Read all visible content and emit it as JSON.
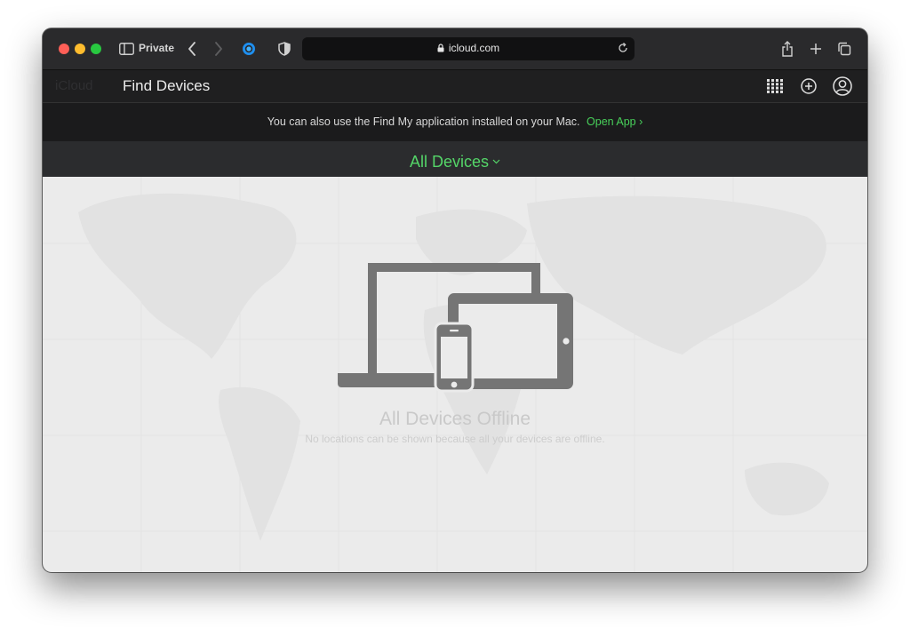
{
  "browser": {
    "private_label": "Private",
    "address": "icloud.com"
  },
  "header": {
    "ghost_brand": "iCloud",
    "title": "Find Devices",
    "icons": [
      "apps-grid-icon",
      "add-circle-icon",
      "account-icon"
    ]
  },
  "banner": {
    "message": "You can also use the Find My application installed on your Mac.",
    "link_label": "Open App",
    "link_arrow": "›"
  },
  "devices_menu": {
    "label": "All Devices"
  },
  "empty_state": {
    "title": "All Devices Offline",
    "subtitle": "No locations can be shown because all your devices are offline."
  },
  "colors": {
    "accent_green": "#48d05a",
    "traffic_close": "#ff5f57",
    "traffic_minimize": "#febc2e",
    "traffic_zoom": "#28c840",
    "device_gray": "#757575"
  }
}
